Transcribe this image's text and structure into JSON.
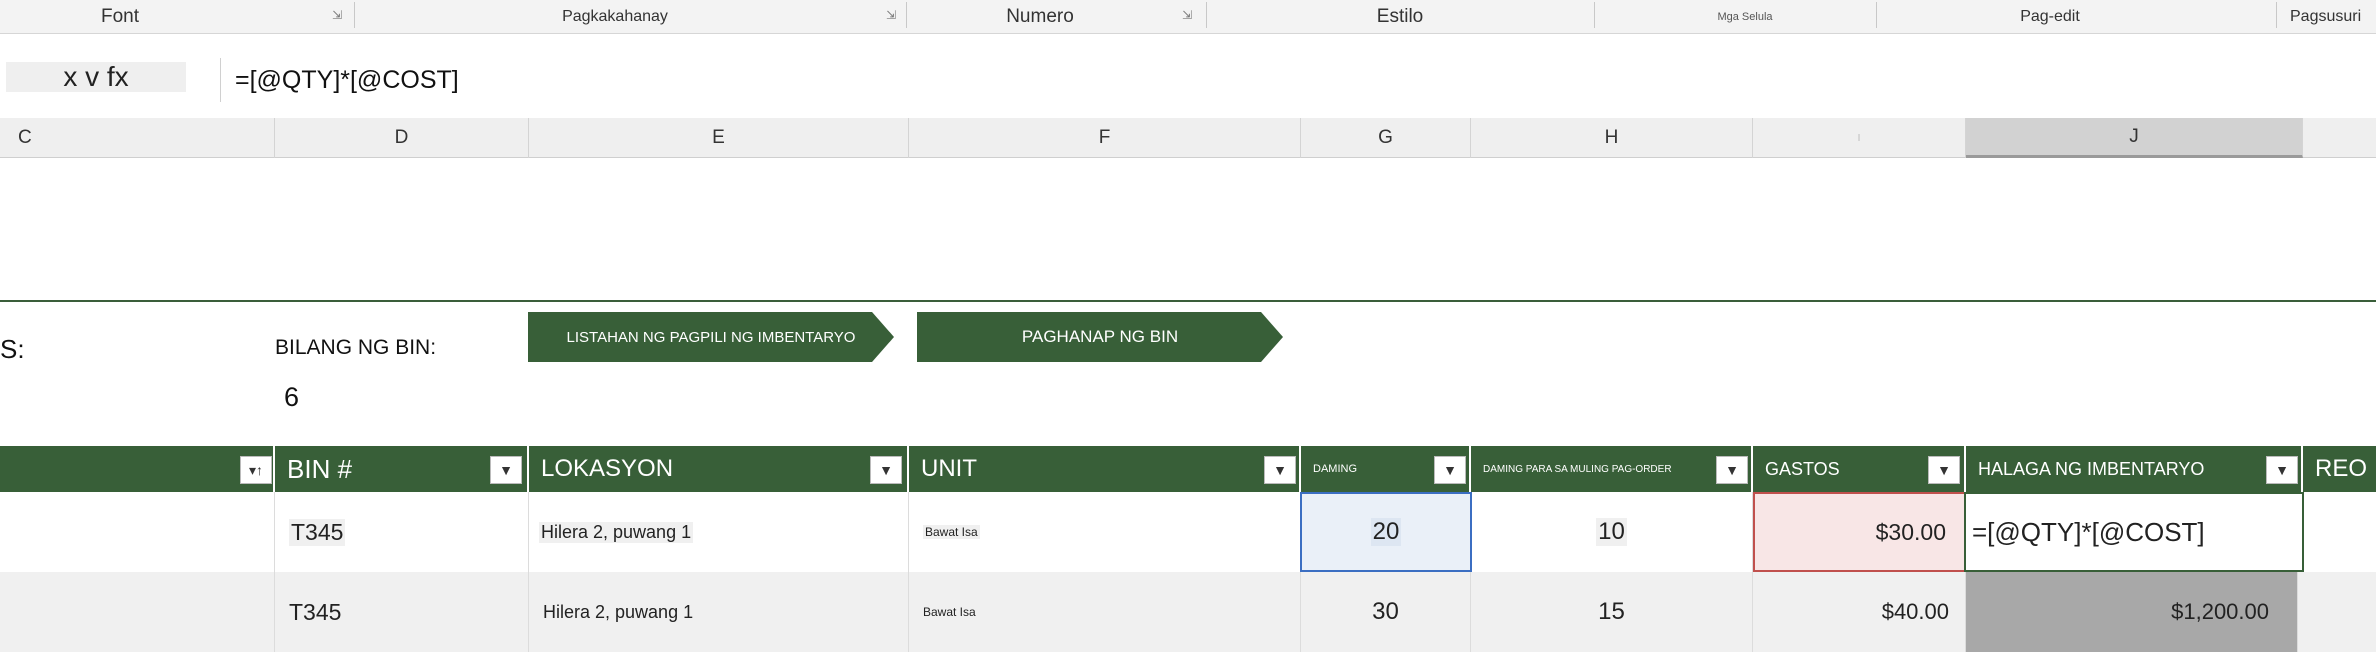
{
  "ribbon": {
    "groups": [
      "Font",
      "Pagkakahanay",
      "Numero",
      "Estilo",
      "Mga Selula",
      "Pag-edit",
      "Pagsusuri"
    ]
  },
  "formula_bar": {
    "name_box": "x v fx",
    "formula": "=[@QTY]*[@COST]"
  },
  "columns": [
    "C",
    "D",
    "E",
    "F",
    "G",
    "H",
    "I",
    "J"
  ],
  "summary": {
    "left_label": "S:",
    "bin_count_label": "BILANG NG BIN:",
    "bin_count_value": "6"
  },
  "buttons": {
    "pick_list": "LISTAHAN NG PAGPILI NG IMBENTARYO",
    "bin_lookup": "PAGHANAP NG BIN"
  },
  "table": {
    "headers": [
      "BIN #",
      "LOKASYON",
      "UNIT",
      "DAMING",
      "DAMING PARA SA MULING PAG-ORDER",
      "GASTOS",
      "HALAGA NG IMBENTARYO",
      "REO"
    ],
    "rows": [
      {
        "bin": "T345",
        "location": "Hilera 2, puwang 1",
        "unit": "Bawat Isa",
        "qty": "20",
        "reorder": "10",
        "cost": "$30.00",
        "value": "=[@QTY]*[@COST]"
      },
      {
        "bin": "T345",
        "location": "Hilera 2, puwang 1",
        "unit": "Bawat Isa",
        "qty": "30",
        "reorder": "15",
        "cost": "$40.00",
        "value": "$1,200.00"
      }
    ]
  },
  "colors": {
    "header_green": "#385f38",
    "selected_qty_border": "#3b6ec2",
    "cost_error_fill": "#f8e6e6",
    "cost_error_border": "#c0504d"
  }
}
